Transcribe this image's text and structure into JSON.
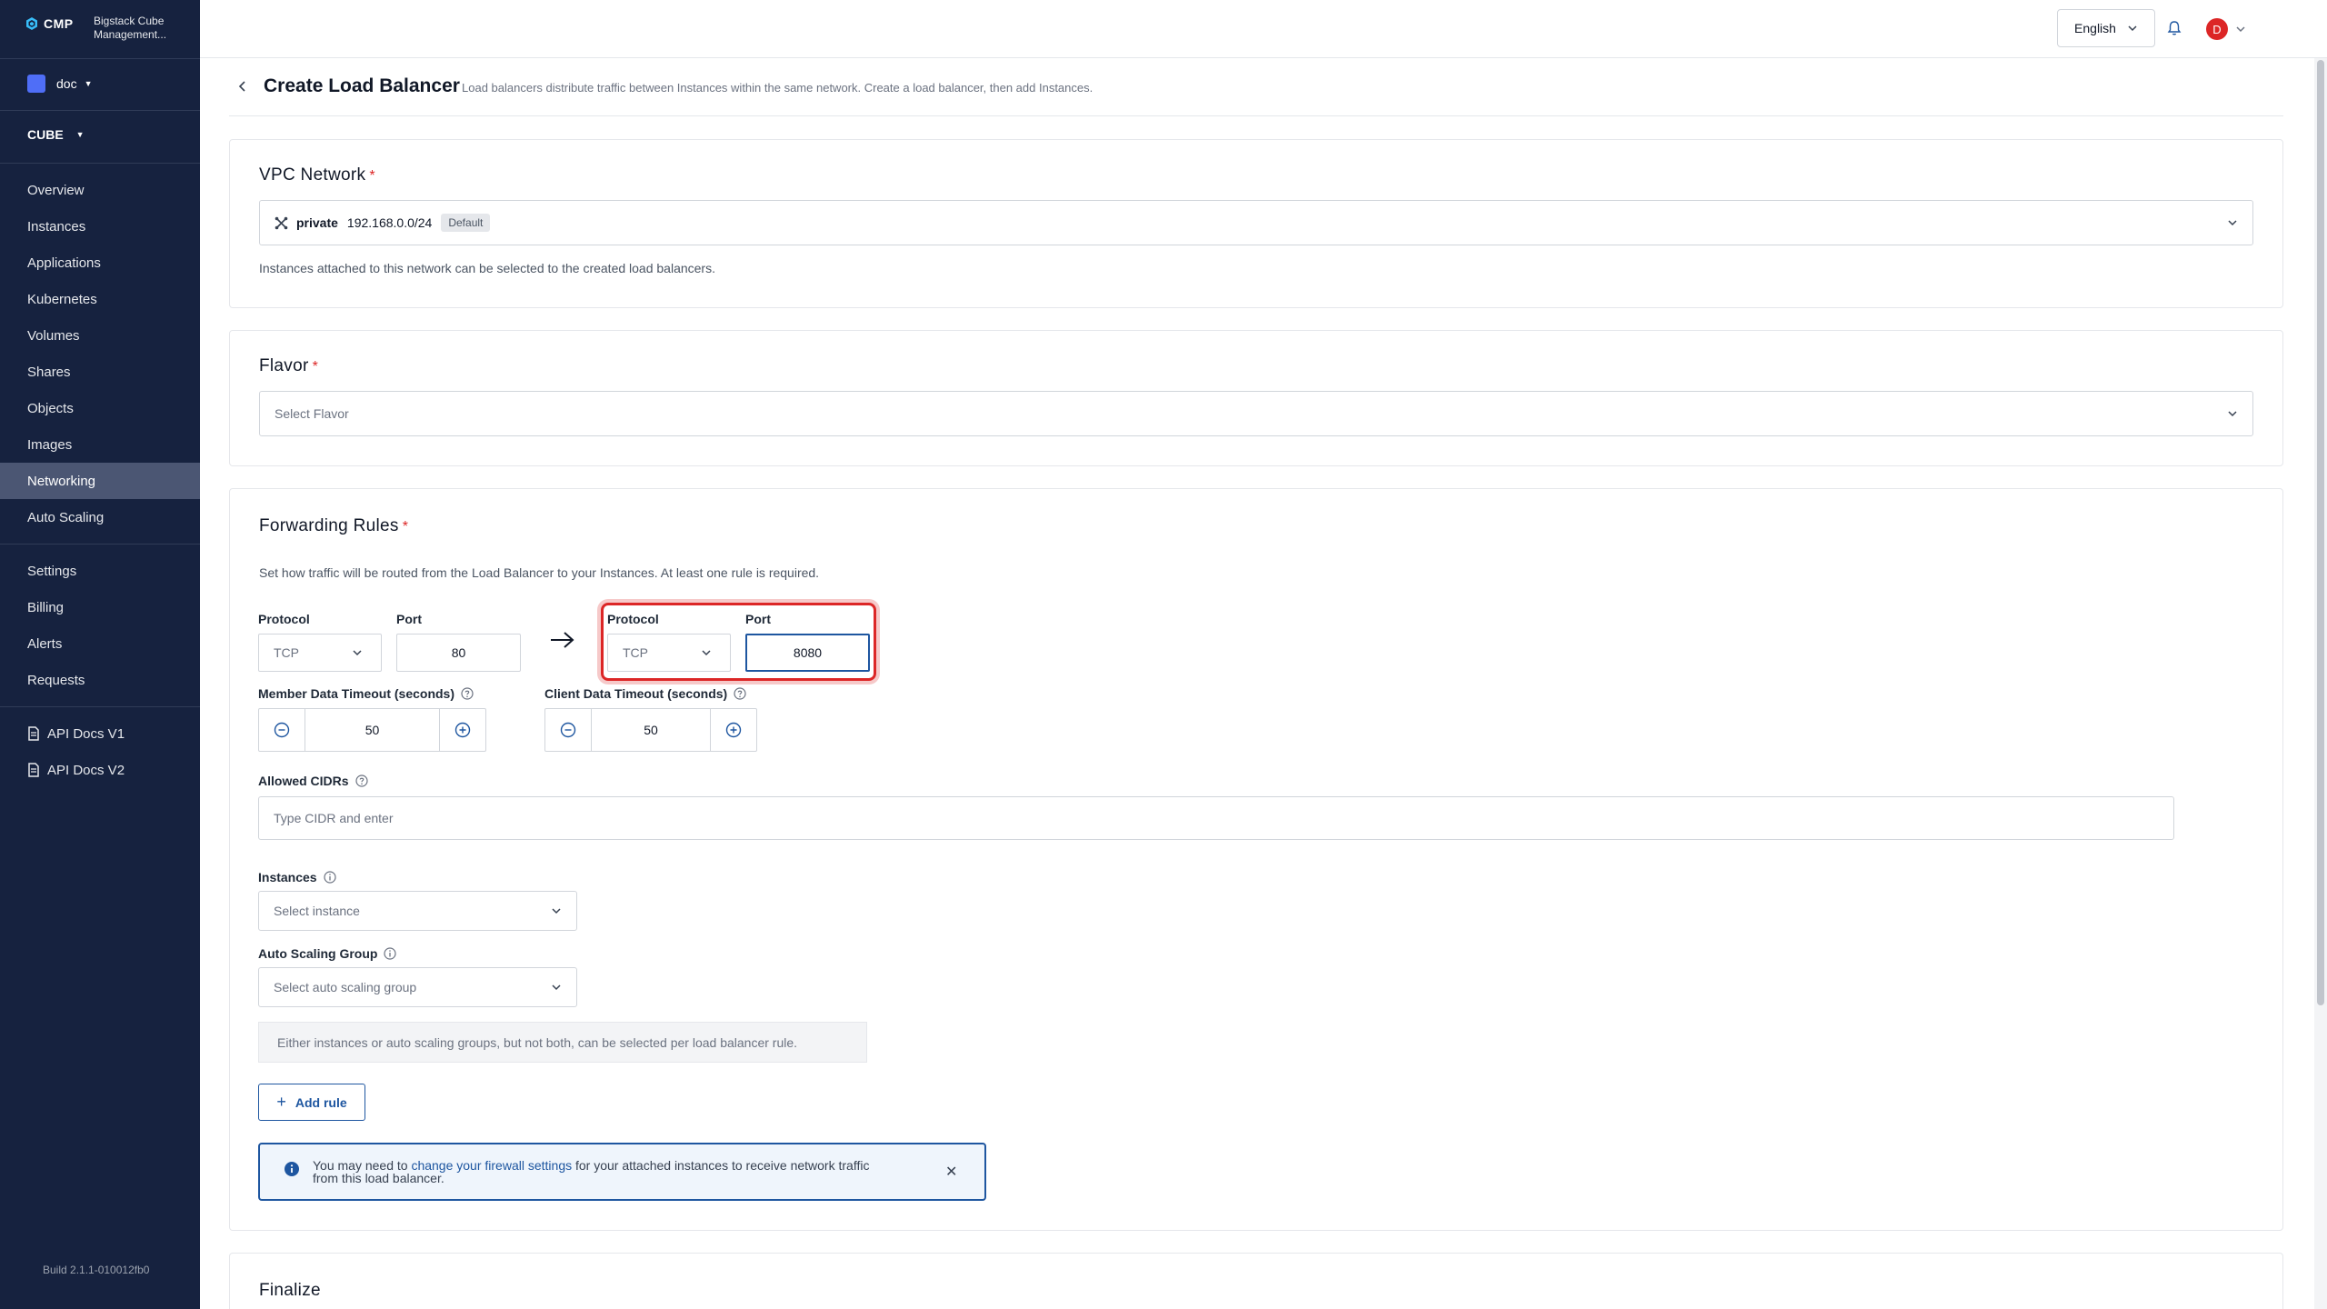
{
  "sidebar": {
    "brand": {
      "name": "CMP",
      "description": "Bigstack Cube Management..."
    },
    "project": {
      "name": "doc"
    },
    "region": {
      "name": "CUBE"
    },
    "nav_primary": [
      "Overview",
      "Instances",
      "Applications",
      "Kubernetes",
      "Volumes",
      "Shares",
      "Objects",
      "Images",
      "Networking",
      "Auto Scaling"
    ],
    "nav_secondary": [
      "Settings",
      "Billing",
      "Alerts",
      "Requests"
    ],
    "nav_docs": [
      "API Docs V1",
      "API Docs V2"
    ],
    "active_item": "Networking",
    "build": "Build 2.1.1-010012fb0"
  },
  "topbar": {
    "language": "English",
    "avatar_initial": "D"
  },
  "page": {
    "title": "Create Load Balancer",
    "subtitle": "Load balancers distribute traffic between Instances within the same network. Create a load balancer, then add Instances."
  },
  "vpc": {
    "title": "VPC Network",
    "network_name": "private",
    "network_cidr": "192.168.0.0/24",
    "badge": "Default",
    "help_text": "Instances attached to this network can be selected to the created load balancers."
  },
  "flavor": {
    "title": "Flavor",
    "placeholder": "Select Flavor"
  },
  "forwarding": {
    "title": "Forwarding Rules",
    "description": "Set how traffic will be routed from the Load Balancer to your Instances. At least one rule is required.",
    "source": {
      "protocol_label": "Protocol",
      "protocol_value": "TCP",
      "port_label": "Port",
      "port_value": "80"
    },
    "target": {
      "protocol_label": "Protocol",
      "protocol_value": "TCP",
      "port_label": "Port",
      "port_value": "8080"
    },
    "member_timeout": {
      "label": "Member Data Timeout (seconds)",
      "value": "50"
    },
    "client_timeout": {
      "label": "Client Data Timeout (seconds)",
      "value": "50"
    },
    "allowed_cidrs": {
      "label": "Allowed CIDRs",
      "placeholder": "Type CIDR and enter"
    },
    "instances": {
      "label": "Instances",
      "placeholder": "Select instance"
    },
    "asg": {
      "label": "Auto Scaling Group",
      "placeholder": "Select auto scaling group"
    },
    "note": "Either instances or auto scaling groups, but not both, can be selected per load balancer rule.",
    "add_rule": "Add rule",
    "alert": {
      "prefix": "You may need to ",
      "link": "change your firewall settings",
      "suffix": " for your attached instances to receive network traffic from this load balancer."
    }
  },
  "finalize": {
    "title": "Finalize"
  },
  "colors": {
    "sidebar": "#16223f",
    "accent": "#1e56a0",
    "required": "#dc2626"
  }
}
